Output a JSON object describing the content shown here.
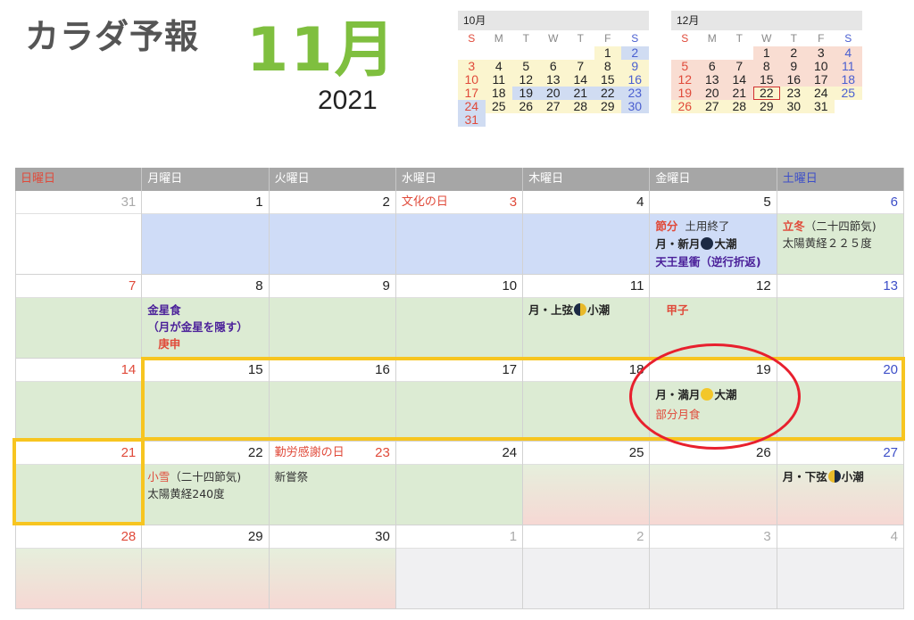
{
  "header": {
    "title": "カラダ予報",
    "month": "11月",
    "year": "2021"
  },
  "mini_cals": [
    {
      "title": "10月",
      "dow": [
        "S",
        "M",
        "T",
        "W",
        "T",
        "F",
        "S"
      ],
      "weeks": [
        [
          "",
          "",
          "",
          "",
          "",
          "1",
          "2"
        ],
        [
          "3",
          "4",
          "5",
          "6",
          "7",
          "8",
          "9"
        ],
        [
          "10",
          "11",
          "12",
          "13",
          "14",
          "15",
          "16"
        ],
        [
          "17",
          "18",
          "19",
          "20",
          "21",
          "22",
          "23"
        ],
        [
          "24",
          "25",
          "26",
          "27",
          "28",
          "29",
          "30"
        ],
        [
          "31",
          "",
          "",
          "",
          "",
          "",
          ""
        ]
      ]
    },
    {
      "title": "12月",
      "dow": [
        "S",
        "M",
        "T",
        "W",
        "T",
        "F",
        "S"
      ],
      "weeks": [
        [
          "",
          "",
          "",
          "1",
          "2",
          "3",
          "4"
        ],
        [
          "5",
          "6",
          "7",
          "8",
          "9",
          "10",
          "11"
        ],
        [
          "12",
          "13",
          "14",
          "15",
          "16",
          "17",
          "18"
        ],
        [
          "19",
          "20",
          "21",
          "22",
          "23",
          "24",
          "25"
        ],
        [
          "26",
          "27",
          "28",
          "29",
          "30",
          "31",
          ""
        ]
      ]
    }
  ],
  "weekdays": [
    "日曜日",
    "月曜日",
    "火曜日",
    "水曜日",
    "木曜日",
    "金曜日",
    "土曜日"
  ],
  "weeks": [
    {
      "days": [
        "31",
        "1",
        "2",
        "3",
        "4",
        "5",
        "6"
      ]
    },
    {
      "days": [
        "7",
        "8",
        "9",
        "10",
        "11",
        "12",
        "13"
      ]
    },
    {
      "days": [
        "14",
        "15",
        "16",
        "17",
        "18",
        "19",
        "20"
      ]
    },
    {
      "days": [
        "21",
        "22",
        "23",
        "24",
        "25",
        "26",
        "27"
      ]
    },
    {
      "days": [
        "28",
        "29",
        "30",
        "1",
        "2",
        "3",
        "4"
      ]
    }
  ],
  "holidays": {
    "bunka": "文化の日",
    "kinro": "勤労感謝の日"
  },
  "events": {
    "d5_setsubun": "節分",
    "d5_doyo": "土用終了",
    "d5_moon_pre": "月・新月",
    "d5_moon_post": "大潮",
    "d5_uranus": "天王星衝（逆行折返)",
    "d6_rittou": "立冬",
    "d6_sekki": "（二十四節気)",
    "d6_kei": "太陽黄経２２５度",
    "d8_venus": "金星食",
    "d8_venus2": "（月が金星を隠す）",
    "d8_koushin": "庚申",
    "d11_moon_pre": "月・上弦",
    "d11_moon_post": "小潮",
    "d12_kasshi": "甲子",
    "d19_moon_pre": "月・満月",
    "d19_moon_post": "大潮",
    "d19_eclipse": "部分月食",
    "d22_shousetsu": "小雪",
    "d22_sekki": "（二十四節気)",
    "d22_kei": "太陽黄経240度",
    "d23_niiname": "新嘗祭",
    "d27_moon_pre": "月・下弦",
    "d27_moon_post": "小潮"
  },
  "colors": {
    "month": "#7fbf3f",
    "sunday": "#e04a3a",
    "saturday": "#3d4fc8",
    "highlight": "#f7c520",
    "circle": "#e8202e"
  }
}
